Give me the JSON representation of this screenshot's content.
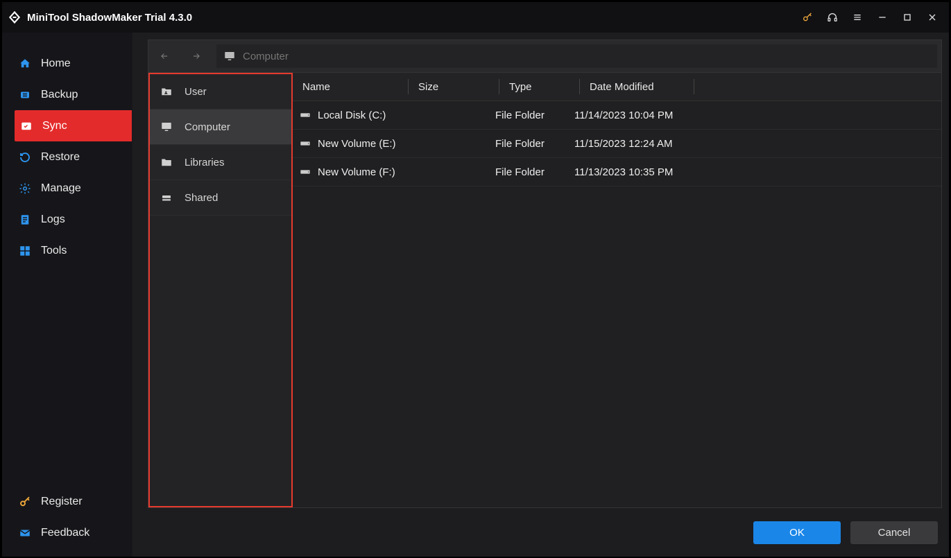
{
  "title": "MiniTool ShadowMaker Trial 4.3.0",
  "nav": {
    "home": "Home",
    "backup": "Backup",
    "sync": "Sync",
    "restore": "Restore",
    "manage": "Manage",
    "logs": "Logs",
    "tools": "Tools",
    "register": "Register",
    "feedback": "Feedback"
  },
  "path": {
    "placeholder": "Computer",
    "value": ""
  },
  "tree": {
    "user": "User",
    "computer": "Computer",
    "libraries": "Libraries",
    "shared": "Shared"
  },
  "columns": {
    "name": "Name",
    "size": "Size",
    "type": "Type",
    "date": "Date Modified"
  },
  "rows": [
    {
      "name": "Local Disk (C:)",
      "type": "File Folder",
      "date": "11/14/2023 10:04 PM"
    },
    {
      "name": "New Volume (E:)",
      "type": "File Folder",
      "date": "11/15/2023 12:24 AM"
    },
    {
      "name": "New Volume (F:)",
      "type": "File Folder",
      "date": "11/13/2023 10:35 PM"
    }
  ],
  "buttons": {
    "ok": "OK",
    "cancel": "Cancel"
  }
}
